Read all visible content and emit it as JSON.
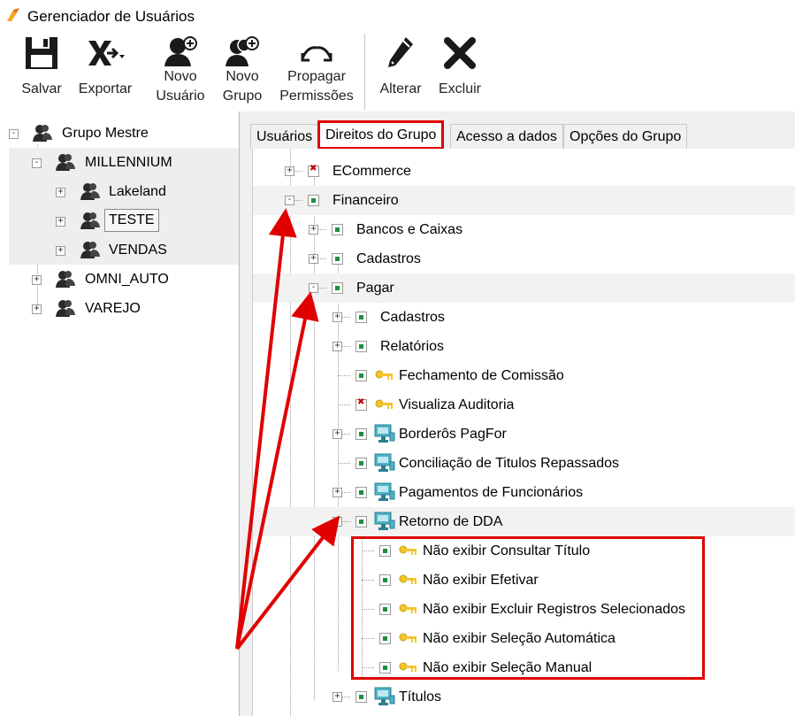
{
  "window": {
    "title": "Gerenciador de Usuários"
  },
  "toolbar": {
    "save": [
      "Salvar"
    ],
    "export": [
      "Exportar"
    ],
    "new_user": [
      "Novo",
      "Usuário"
    ],
    "new_group": [
      "Novo",
      "Grupo"
    ],
    "propagate": [
      "Propagar",
      "Permissões"
    ],
    "edit": [
      "Alterar"
    ],
    "delete": [
      "Excluir"
    ]
  },
  "tree": {
    "root": "Grupo Mestre",
    "items": [
      {
        "label": "MILLENNIUM"
      },
      {
        "label": "Lakeland"
      },
      {
        "label": "TESTE"
      },
      {
        "label": "VENDAS"
      },
      {
        "label": "OMNI_AUTO"
      },
      {
        "label": "VAREJO"
      }
    ]
  },
  "tabs": [
    {
      "label": "Usuários"
    },
    {
      "label": "Direitos do Grupo"
    },
    {
      "label": "Acesso a dados"
    },
    {
      "label": "Opções do Grupo"
    }
  ],
  "permissions": [
    {
      "label": "ECommerce",
      "checked": false,
      "icon": "none",
      "expand": "+"
    },
    {
      "label": "Financeiro",
      "checked": true,
      "icon": "none",
      "expand": "-"
    },
    {
      "label": "Bancos e Caixas",
      "checked": true,
      "icon": "none",
      "expand": "+"
    },
    {
      "label": "Cadastros",
      "checked": true,
      "icon": "none",
      "expand": "+"
    },
    {
      "label": "Pagar",
      "checked": true,
      "icon": "none",
      "expand": "-"
    },
    {
      "label": "Cadastros",
      "checked": true,
      "icon": "none",
      "expand": "+"
    },
    {
      "label": "Relatórios",
      "checked": true,
      "icon": "none",
      "expand": "+"
    },
    {
      "label": "Fechamento de Comissão",
      "checked": true,
      "icon": "key",
      "expand": ""
    },
    {
      "label": "Visualiza Auditoria",
      "checked": false,
      "icon": "key",
      "expand": ""
    },
    {
      "label": "Borderôs PagFor",
      "checked": true,
      "icon": "monitor",
      "expand": "+"
    },
    {
      "label": "Conciliação de Titulos Repassados",
      "checked": true,
      "icon": "monitor",
      "expand": ""
    },
    {
      "label": "Pagamentos de Funcionários",
      "checked": true,
      "icon": "monitor",
      "expand": "+"
    },
    {
      "label": "Retorno de DDA",
      "checked": true,
      "icon": "monitor",
      "expand": "-"
    },
    {
      "label": "Não exibir Consultar Título",
      "checked": true,
      "icon": "key",
      "expand": ""
    },
    {
      "label": "Não exibir Efetivar",
      "checked": true,
      "icon": "key",
      "expand": ""
    },
    {
      "label": "Não exibir Excluir Registros Selecionados",
      "checked": true,
      "icon": "key",
      "expand": ""
    },
    {
      "label": "Não exibir Seleção Automática",
      "checked": true,
      "icon": "key",
      "expand": ""
    },
    {
      "label": "Não exibir Seleção Manual",
      "checked": true,
      "icon": "key",
      "expand": ""
    },
    {
      "label": "Títulos",
      "checked": true,
      "icon": "monitor",
      "expand": "+"
    }
  ],
  "colors": {
    "annotation_red": "#e00000",
    "check_green": "#1e8e3e",
    "check_red": "#c00000"
  }
}
